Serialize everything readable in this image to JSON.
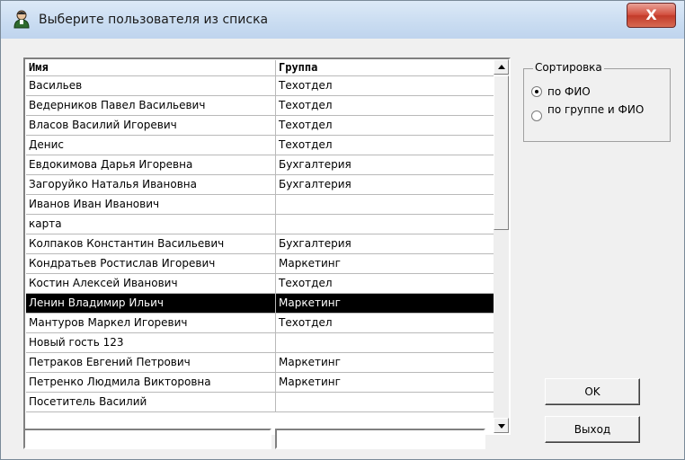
{
  "window": {
    "title": "Выберите пользователя из списка",
    "close_label": "X"
  },
  "grid": {
    "headers": [
      "Имя",
      "Группа"
    ],
    "rows": [
      {
        "name": "Васильев",
        "group": "Техотдел"
      },
      {
        "name": "Ведерников Павел Васильевич",
        "group": "Техотдел"
      },
      {
        "name": "Власов Василий Игоревич",
        "group": "Техотдел"
      },
      {
        "name": "Денис",
        "group": "Техотдел"
      },
      {
        "name": "Евдокимова Дарья Игоревна",
        "group": "Бухгалтерия"
      },
      {
        "name": "Загоруйко Наталья Ивановна",
        "group": "Бухгалтерия"
      },
      {
        "name": "Иванов Иван Иванович",
        "group": ""
      },
      {
        "name": "карта",
        "group": ""
      },
      {
        "name": "Колпаков Константин Васильевич",
        "group": "Бухгалтерия"
      },
      {
        "name": "Кондратьев Ростислав Игоревич",
        "group": "Маркетинг"
      },
      {
        "name": "Костин Алексей Иванович",
        "group": "Техотдел"
      },
      {
        "name": "Ленин Владимир Ильич",
        "group": "Маркетинг"
      },
      {
        "name": "Мантуров Маркел Игоревич",
        "group": "Техотдел"
      },
      {
        "name": "Новый гость 123",
        "group": ""
      },
      {
        "name": "Петраков Евгений Петрович",
        "group": "Маркетинг"
      },
      {
        "name": "Петренко Людмила Викторовна",
        "group": "Маркетинг"
      },
      {
        "name": "Посетитель Василий",
        "group": ""
      }
    ],
    "selected_index": 11
  },
  "filters": {
    "name_value": "",
    "group_value": ""
  },
  "sort": {
    "legend": "Сортировка",
    "options": [
      "по ФИО",
      "по группе и ФИО"
    ],
    "selected_index": 0
  },
  "buttons": {
    "ok": "OK",
    "exit": "Выход"
  },
  "icons": {
    "app": "user-avatar-icon",
    "close": "close-icon",
    "scroll_up": "arrow-up-icon",
    "scroll_down": "arrow-down-icon"
  },
  "colors": {
    "selection_bg": "#000000",
    "selection_fg": "#ffffff",
    "close_button": "#c9442f"
  }
}
